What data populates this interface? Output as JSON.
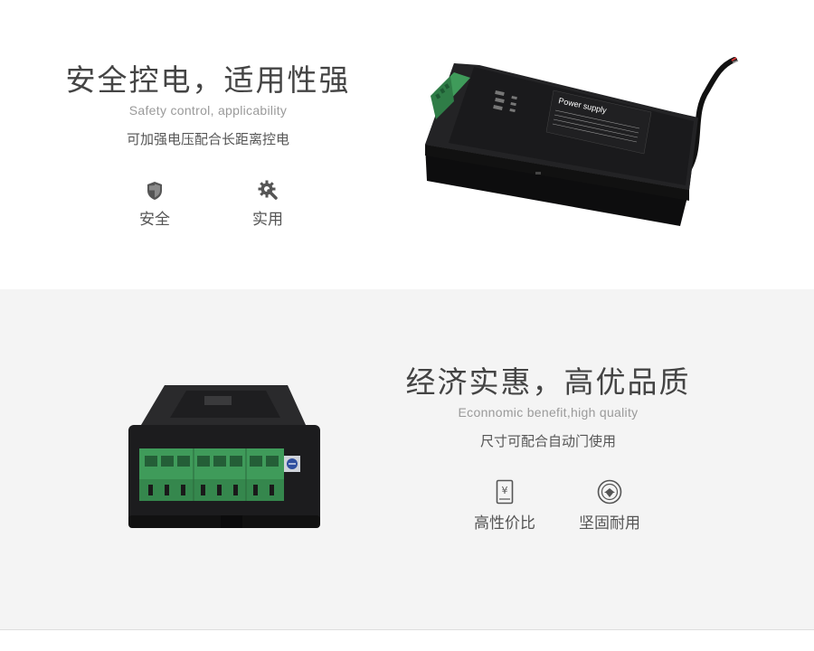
{
  "section1": {
    "title": "安全控电，适用性强",
    "subtitle": "Safety control, applicability",
    "description": "可加强电压配合长距离控电",
    "features": [
      {
        "icon": "shield-icon",
        "label": "安全"
      },
      {
        "icon": "gear-wrench-icon",
        "label": "实用"
      }
    ],
    "device_label": "Power supply",
    "device_label_color": "#ffffff"
  },
  "section2": {
    "title": "经济实惠，高优品质",
    "subtitle": "Econnomic benefit,high quality",
    "description": "尺寸可配合自动门使用",
    "features": [
      {
        "icon": "price-tag-yen-icon",
        "label": "高性价比"
      },
      {
        "icon": "quality-badge-icon",
        "label": "坚固耐用"
      }
    ],
    "terminal_color": "#3f9b5a"
  },
  "colors": {
    "device_body": "#1c1c1e",
    "section2_bg": "#f4f4f4",
    "icon_gray": "#555555"
  }
}
